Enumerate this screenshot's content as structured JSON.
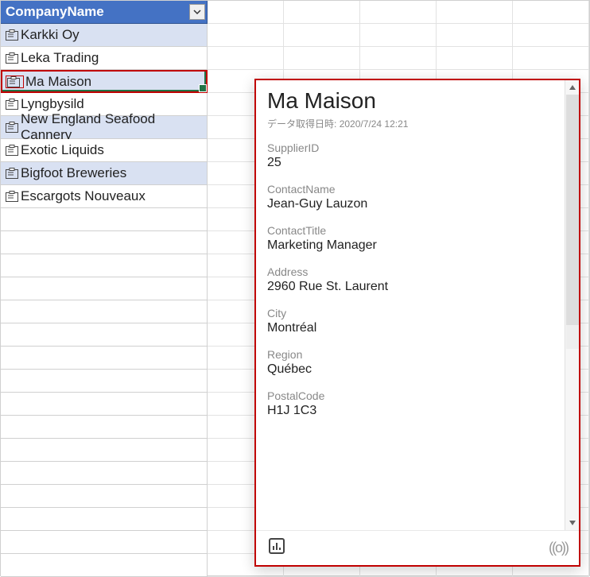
{
  "table": {
    "header": "CompanyName",
    "rows": [
      "Karkki Oy",
      "Leka Trading",
      "Ma Maison",
      "Lyngbysild",
      "New England Seafood Cannery",
      "Exotic Liquids",
      "Bigfoot Breweries",
      "Escargots Nouveaux"
    ],
    "selectedIndex": 2
  },
  "card": {
    "title": "Ma Maison",
    "meta_label": "データ取得日時:",
    "meta_value": "2020/7/24 12:21",
    "fields": [
      {
        "label": "SupplierID",
        "value": "25"
      },
      {
        "label": "ContactName",
        "value": "Jean-Guy Lauzon"
      },
      {
        "label": "ContactTitle",
        "value": "Marketing Manager"
      },
      {
        "label": "Address",
        "value": "2960 Rue St. Laurent"
      },
      {
        "label": "City",
        "value": "Montréal"
      },
      {
        "label": "Region",
        "value": "Québec"
      },
      {
        "label": "PostalCode",
        "value": "H1J 1C3"
      }
    ]
  }
}
